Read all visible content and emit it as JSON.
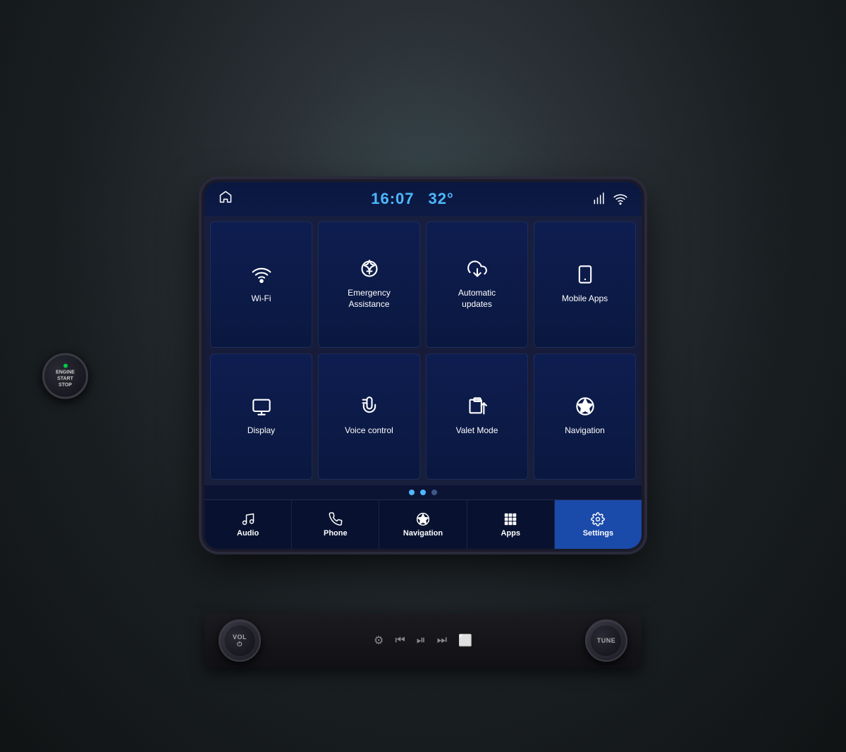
{
  "header": {
    "time": "16:07",
    "temperature": "32°",
    "home_icon": "⌂"
  },
  "grid": {
    "items": [
      {
        "id": "wifi",
        "label": "Wi-Fi",
        "icon": "wifi"
      },
      {
        "id": "emergency",
        "label": "Emergency\nAssistance",
        "icon": "emergency"
      },
      {
        "id": "updates",
        "label": "Automatic\nupdates",
        "icon": "updates"
      },
      {
        "id": "mobile-apps",
        "label": "Mobile Apps",
        "icon": "mobile-apps"
      },
      {
        "id": "display",
        "label": "Display",
        "icon": "display"
      },
      {
        "id": "voice",
        "label": "Voice control",
        "icon": "voice"
      },
      {
        "id": "valet",
        "label": "Valet Mode",
        "icon": "valet"
      },
      {
        "id": "navigation",
        "label": "Navigation",
        "icon": "navigation"
      }
    ]
  },
  "dots": [
    {
      "active": true
    },
    {
      "active": true
    },
    {
      "active": false
    }
  ],
  "bottom_nav": [
    {
      "id": "audio",
      "label": "Audio",
      "icon": "music",
      "active": false
    },
    {
      "id": "phone",
      "label": "Phone",
      "icon": "phone",
      "active": false
    },
    {
      "id": "navigation",
      "label": "Navigation",
      "icon": "nav",
      "active": false
    },
    {
      "id": "apps",
      "label": "Apps",
      "icon": "apps",
      "active": false
    },
    {
      "id": "settings",
      "label": "Settings",
      "icon": "settings",
      "active": true
    }
  ],
  "controls": {
    "vol_label": "VOL",
    "tune_label": "TUNE",
    "engine_line1": "ENGINE",
    "engine_line2": "START",
    "engine_line3": "STOP"
  }
}
